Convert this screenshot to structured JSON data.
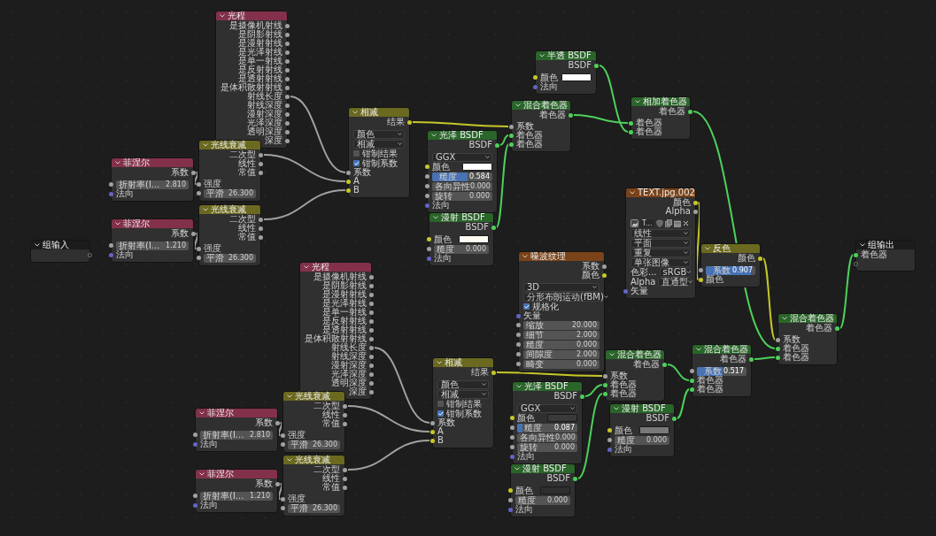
{
  "nodes": [
    {
      "title": "组输入",
      "kind": "group",
      "rows": [
        {
          "kind": "empty_output"
        }
      ]
    },
    {
      "title": "光程",
      "kind": "input",
      "rows": [
        {
          "kind": "output",
          "label": "是摄像机射线",
          "socket": {
            "color": "#a1a1a1"
          }
        },
        {
          "kind": "output",
          "label": "是阴影射线",
          "socket": {
            "color": "#a1a1a1"
          }
        },
        {
          "kind": "output",
          "label": "是漫射射线",
          "socket": {
            "color": "#a1a1a1"
          }
        },
        {
          "kind": "output",
          "label": "是光泽射线",
          "socket": {
            "color": "#a1a1a1"
          }
        },
        {
          "kind": "output",
          "label": "是单一射线",
          "socket": {
            "color": "#a1a1a1"
          }
        },
        {
          "kind": "output",
          "label": "是反射射线",
          "socket": {
            "color": "#a1a1a1"
          }
        },
        {
          "kind": "output",
          "label": "是透射射线",
          "socket": {
            "color": "#a1a1a1"
          }
        },
        {
          "kind": "output",
          "label": "是体积散射射线",
          "socket": {
            "color": "#a1a1a1"
          }
        },
        {
          "kind": "output",
          "label": "射线长度",
          "socket": {
            "color": "#a1a1a1"
          }
        },
        {
          "kind": "output",
          "label": "射线深度",
          "socket": {
            "color": "#a1a1a1"
          }
        },
        {
          "kind": "output",
          "label": "漫射深度",
          "socket": {
            "color": "#a1a1a1"
          }
        },
        {
          "kind": "output",
          "label": "光泽深度",
          "socket": {
            "color": "#a1a1a1"
          }
        },
        {
          "kind": "output",
          "label": "透明深度",
          "socket": {
            "color": "#a1a1a1"
          }
        },
        {
          "kind": "output",
          "label": "深度",
          "socket": {
            "color": "#a1a1a1"
          }
        }
      ]
    },
    {
      "title": "菲涅尔",
      "kind": "input",
      "rows": [
        {
          "kind": "output",
          "label": "系数",
          "socket": {
            "color": "#a1a1a1"
          }
        },
        {
          "kind": "field",
          "label": "折射率(I...",
          "value": "2.810",
          "socket": {
            "color": "#a1a1a1"
          }
        },
        {
          "kind": "input",
          "label": "法向",
          "socket": {
            "color": "#6363c7"
          }
        }
      ]
    },
    {
      "title": "光线衰减",
      "kind": "color",
      "rows": [
        {
          "kind": "output",
          "label": "二次型",
          "socket": {
            "color": "#a1a1a1"
          }
        },
        {
          "kind": "output",
          "label": "线性",
          "socket": {
            "color": "#a1a1a1"
          }
        },
        {
          "kind": "output",
          "label": "常值",
          "socket": {
            "color": "#a1a1a1"
          }
        },
        {
          "kind": "input",
          "label": "强度",
          "socket": {
            "color": "#a1a1a1"
          }
        },
        {
          "kind": "field",
          "label": "平滑",
          "value": "26.300",
          "socket": {
            "color": "#a1a1a1"
          }
        }
      ]
    },
    {
      "title": "菲涅尔",
      "kind": "input",
      "rows": [
        {
          "kind": "output",
          "label": "系数",
          "socket": {
            "color": "#a1a1a1"
          }
        },
        {
          "kind": "field",
          "label": "折射率(I...",
          "value": "1.210",
          "socket": {
            "color": "#a1a1a1"
          }
        },
        {
          "kind": "input",
          "label": "法向",
          "socket": {
            "color": "#6363c7"
          }
        }
      ]
    },
    {
      "title": "光线衰减",
      "kind": "color",
      "rows": [
        {
          "kind": "output",
          "label": "二次型",
          "socket": {
            "color": "#a1a1a1"
          }
        },
        {
          "kind": "output",
          "label": "线性",
          "socket": {
            "color": "#a1a1a1"
          }
        },
        {
          "kind": "output",
          "label": "常值",
          "socket": {
            "color": "#a1a1a1"
          }
        },
        {
          "kind": "input",
          "label": "强度",
          "socket": {
            "color": "#a1a1a1"
          }
        },
        {
          "kind": "field",
          "label": "平滑",
          "value": "26.300",
          "socket": {
            "color": "#a1a1a1"
          }
        }
      ]
    },
    {
      "title": "相减",
      "kind": "color",
      "rows": [
        {
          "kind": "output",
          "label": "结果",
          "socket": {
            "color": "#c7c729"
          }
        },
        {
          "kind": "dropdown",
          "value": "颜色"
        },
        {
          "kind": "dropdown",
          "value": "相减"
        },
        {
          "kind": "checkbox",
          "label": "钳制结果",
          "checked": false
        },
        {
          "kind": "checkbox",
          "label": "钳制系数",
          "checked": true
        },
        {
          "kind": "input",
          "label": "系数",
          "socket": {
            "color": "#a1a1a1"
          }
        },
        {
          "kind": "input",
          "label": "A",
          "socket": {
            "color": "#c7c729"
          }
        },
        {
          "kind": "input",
          "label": "B",
          "socket": {
            "color": "#c7c729"
          }
        }
      ]
    },
    {
      "title": "光泽 BSDF",
      "kind": "shader",
      "rows": [
        {
          "kind": "output",
          "label": "BSDF",
          "socket": {
            "color": "#4dd05a"
          }
        },
        {
          "kind": "dropdown",
          "value": "GGX"
        },
        {
          "kind": "color",
          "label": "颜色",
          "color": "#ffffff",
          "socket": {
            "color": "#c7c729"
          }
        },
        {
          "kind": "slider",
          "label": "糙度",
          "value": "0.584",
          "level": 0.584,
          "socket": {
            "color": "#a1a1a1"
          }
        },
        {
          "kind": "field",
          "label": "各向异性",
          "value": "0.000",
          "socket": {
            "color": "#a1a1a1"
          }
        },
        {
          "kind": "field",
          "label": "旋转",
          "value": "0.000",
          "socket": {
            "color": "#a1a1a1"
          }
        },
        {
          "kind": "input",
          "label": "法向",
          "socket": {
            "color": "#6363c7"
          }
        }
      ]
    },
    {
      "title": "漫射 BSDF",
      "kind": "shader",
      "rows": [
        {
          "kind": "output",
          "label": "BSDF",
          "socket": {
            "color": "#4dd05a"
          }
        },
        {
          "kind": "color",
          "label": "颜色",
          "color": "#fffaf2",
          "socket": {
            "color": "#c7c729"
          }
        },
        {
          "kind": "field",
          "label": "糙度",
          "value": "0.000",
          "socket": {
            "color": "#a1a1a1"
          }
        },
        {
          "kind": "input",
          "label": "法向",
          "socket": {
            "color": "#6363c7"
          }
        }
      ]
    },
    {
      "title": "半透 BSDF",
      "kind": "shader",
      "rows": [
        {
          "kind": "output",
          "label": "BSDF",
          "socket": {
            "color": "#4dd05a"
          }
        },
        {
          "kind": "color",
          "label": "颜色",
          "color": "#ffffff",
          "socket": {
            "color": "#c7c729"
          }
        },
        {
          "kind": "input",
          "label": "法向",
          "socket": {
            "color": "#6363c7"
          }
        }
      ]
    },
    {
      "title": "混合着色器",
      "kind": "shader",
      "rows": [
        {
          "kind": "output",
          "label": "着色器",
          "socket": {
            "color": "#4dd05a"
          }
        },
        {
          "kind": "input",
          "label": "系数",
          "socket": {
            "color": "#a1a1a1"
          }
        },
        {
          "kind": "input",
          "label": "着色器",
          "socket": {
            "color": "#4dd05a"
          }
        },
        {
          "kind": "input",
          "label": "着色器",
          "socket": {
            "color": "#4dd05a"
          }
        }
      ]
    },
    {
      "title": "相加着色器",
      "kind": "shader",
      "rows": [
        {
          "kind": "output",
          "label": "着色器",
          "socket": {
            "color": "#4dd05a"
          }
        },
        {
          "kind": "input",
          "label": "着色器",
          "socket": {
            "color": "#4dd05a"
          }
        },
        {
          "kind": "input",
          "label": "着色器",
          "socket": {
            "color": "#4dd05a"
          }
        }
      ]
    },
    {
      "title": "TEXT.jpg.002",
      "kind": "texture",
      "rows": [
        {
          "kind": "output",
          "label": "颜色",
          "socket": {
            "color": "#c7c729"
          }
        },
        {
          "kind": "output",
          "label": "Alpha",
          "socket": {
            "color": "#a1a1a1"
          }
        },
        {
          "kind": "image_selector",
          "value": "T..."
        },
        {
          "kind": "dropdown",
          "value": "线性"
        },
        {
          "kind": "dropdown",
          "value": "平面"
        },
        {
          "kind": "dropdown",
          "value": "重复"
        },
        {
          "kind": "dropdown",
          "value": "单张图像"
        },
        {
          "kind": "labeled_dropdown",
          "label": "色彩...",
          "value": "sRGB"
        },
        {
          "kind": "labeled_dropdown",
          "label": "Alpha",
          "value": "直通型"
        },
        {
          "kind": "input",
          "label": "矢量",
          "socket": {
            "color": "#6363c7"
          }
        }
      ]
    },
    {
      "title": "反色",
      "kind": "color",
      "rows": [
        {
          "kind": "output",
          "label": "颜色",
          "socket": {
            "color": "#c7c729"
          }
        },
        {
          "kind": "slider",
          "label": "系数",
          "value": "0.907",
          "level": 0.907,
          "socket": {
            "color": "#a1a1a1"
          }
        },
        {
          "kind": "input",
          "label": "颜色",
          "socket": {
            "color": "#c7c729"
          }
        }
      ]
    },
    {
      "title": "组输出",
      "kind": "group",
      "rows": [
        {
          "kind": "input",
          "label": "着色器",
          "socket": {
            "color": "#4dd05a"
          }
        },
        {
          "kind": "empty_input"
        }
      ]
    },
    {
      "title": "光程",
      "kind": "input",
      "rows": [
        {
          "kind": "output",
          "label": "是摄像机射线",
          "socket": {
            "color": "#a1a1a1"
          }
        },
        {
          "kind": "output",
          "label": "是阴影射线",
          "socket": {
            "color": "#a1a1a1"
          }
        },
        {
          "kind": "output",
          "label": "是漫射射线",
          "socket": {
            "color": "#a1a1a1"
          }
        },
        {
          "kind": "output",
          "label": "是光泽射线",
          "socket": {
            "color": "#a1a1a1"
          }
        },
        {
          "kind": "output",
          "label": "是单一射线",
          "socket": {
            "color": "#a1a1a1"
          }
        },
        {
          "kind": "output",
          "label": "是反射射线",
          "socket": {
            "color": "#a1a1a1"
          }
        },
        {
          "kind": "output",
          "label": "是透射射线",
          "socket": {
            "color": "#a1a1a1"
          }
        },
        {
          "kind": "output",
          "label": "是体积散射射线",
          "socket": {
            "color": "#a1a1a1"
          }
        },
        {
          "kind": "output",
          "label": "射线长度",
          "socket": {
            "color": "#a1a1a1"
          }
        },
        {
          "kind": "output",
          "label": "射线深度",
          "socket": {
            "color": "#a1a1a1"
          }
        },
        {
          "kind": "output",
          "label": "漫射深度",
          "socket": {
            "color": "#a1a1a1"
          }
        },
        {
          "kind": "output",
          "label": "光泽深度",
          "socket": {
            "color": "#a1a1a1"
          }
        },
        {
          "kind": "output",
          "label": "透明深度",
          "socket": {
            "color": "#a1a1a1"
          }
        },
        {
          "kind": "output",
          "label": "深度",
          "socket": {
            "color": "#a1a1a1"
          }
        }
      ]
    },
    {
      "title": "菲涅尔",
      "kind": "input",
      "rows": [
        {
          "kind": "output",
          "label": "系数",
          "socket": {
            "color": "#a1a1a1"
          }
        },
        {
          "kind": "field",
          "label": "折射率(I...",
          "value": "2.810",
          "socket": {
            "color": "#a1a1a1"
          }
        },
        {
          "kind": "input",
          "label": "法向",
          "socket": {
            "color": "#6363c7"
          }
        }
      ]
    },
    {
      "title": "光线衰减",
      "kind": "color",
      "rows": [
        {
          "kind": "output",
          "label": "二次型",
          "socket": {
            "color": "#a1a1a1"
          }
        },
        {
          "kind": "output",
          "label": "线性",
          "socket": {
            "color": "#a1a1a1"
          }
        },
        {
          "kind": "output",
          "label": "常值",
          "socket": {
            "color": "#a1a1a1"
          }
        },
        {
          "kind": "input",
          "label": "强度",
          "socket": {
            "color": "#a1a1a1"
          }
        },
        {
          "kind": "field",
          "label": "平滑",
          "value": "26.300",
          "socket": {
            "color": "#a1a1a1"
          }
        }
      ]
    },
    {
      "title": "菲涅尔",
      "kind": "input",
      "rows": [
        {
          "kind": "output",
          "label": "系数",
          "socket": {
            "color": "#a1a1a1"
          }
        },
        {
          "kind": "field",
          "label": "折射率(I...",
          "value": "1.210",
          "socket": {
            "color": "#a1a1a1"
          }
        },
        {
          "kind": "input",
          "label": "法向",
          "socket": {
            "color": "#6363c7"
          }
        }
      ]
    },
    {
      "title": "光线衰减",
      "kind": "color",
      "rows": [
        {
          "kind": "output",
          "label": "二次型",
          "socket": {
            "color": "#a1a1a1"
          }
        },
        {
          "kind": "output",
          "label": "线性",
          "socket": {
            "color": "#a1a1a1"
          }
        },
        {
          "kind": "output",
          "label": "常值",
          "socket": {
            "color": "#a1a1a1"
          }
        },
        {
          "kind": "input",
          "label": "强度",
          "socket": {
            "color": "#a1a1a1"
          }
        },
        {
          "kind": "field",
          "label": "平滑",
          "value": "26.300",
          "socket": {
            "color": "#a1a1a1"
          }
        }
      ]
    },
    {
      "title": "相减",
      "kind": "color",
      "rows": [
        {
          "kind": "output",
          "label": "结果",
          "socket": {
            "color": "#c7c729"
          }
        },
        {
          "kind": "dropdown",
          "value": "颜色"
        },
        {
          "kind": "dropdown",
          "value": "相减"
        },
        {
          "kind": "checkbox",
          "label": "钳制结果",
          "checked": false
        },
        {
          "kind": "checkbox",
          "label": "钳制系数",
          "checked": true
        },
        {
          "kind": "input",
          "label": "系数",
          "socket": {
            "color": "#a1a1a1"
          }
        },
        {
          "kind": "input",
          "label": "A",
          "socket": {
            "color": "#c7c729"
          }
        },
        {
          "kind": "input",
          "label": "B",
          "socket": {
            "color": "#c7c729"
          }
        }
      ]
    },
    {
      "title": "噪波纹理",
      "kind": "texture",
      "rows": [
        {
          "kind": "output",
          "label": "系数",
          "socket": {
            "color": "#a1a1a1"
          }
        },
        {
          "kind": "output",
          "label": "颜色",
          "socket": {
            "color": "#c7c729"
          }
        },
        {
          "kind": "dropdown",
          "value": "3D"
        },
        {
          "kind": "dropdown",
          "value": "分形布朗运动(fBM)"
        },
        {
          "kind": "checkbox",
          "label": "规格化",
          "checked": true
        },
        {
          "kind": "input",
          "label": "矢量",
          "socket": {
            "color": "#6363c7"
          }
        },
        {
          "kind": "field",
          "label": "缩放",
          "value": "20.000",
          "socket": {
            "color": "#a1a1a1"
          }
        },
        {
          "kind": "field",
          "label": "细节",
          "value": "2.000",
          "socket": {
            "color": "#a1a1a1"
          }
        },
        {
          "kind": "field",
          "label": "糙度",
          "value": "0.000",
          "socket": {
            "color": "#a1a1a1"
          }
        },
        {
          "kind": "field",
          "label": "间隙度",
          "value": "2.000",
          "socket": {
            "color": "#a1a1a1"
          }
        },
        {
          "kind": "field",
          "label": "畸变",
          "value": "0.000",
          "socket": {
            "color": "#a1a1a1"
          }
        }
      ]
    },
    {
      "title": "光泽 BSDF",
      "kind": "shader",
      "rows": [
        {
          "kind": "output",
          "label": "BSDF",
          "socket": {
            "color": "#4dd05a"
          }
        },
        {
          "kind": "dropdown",
          "value": "GGX"
        },
        {
          "kind": "color",
          "label": "颜色",
          "color": "#3a3a3a",
          "socket": {
            "color": "#c7c729"
          }
        },
        {
          "kind": "slider",
          "label": "糙度",
          "value": "0.087",
          "level": 0.087,
          "socket": {
            "color": "#a1a1a1"
          }
        },
        {
          "kind": "field",
          "label": "各向异性",
          "value": "0.000",
          "socket": {
            "color": "#a1a1a1"
          }
        },
        {
          "kind": "field",
          "label": "旋转",
          "value": "0.000",
          "socket": {
            "color": "#a1a1a1"
          }
        },
        {
          "kind": "input",
          "label": "法向",
          "socket": {
            "color": "#6363c7"
          }
        }
      ]
    },
    {
      "title": "漫射 BSDF",
      "kind": "shader",
      "rows": [
        {
          "kind": "output",
          "label": "BSDF",
          "socket": {
            "color": "#4dd05a"
          }
        },
        {
          "kind": "color",
          "label": "颜色",
          "color": "#2e2e2e",
          "socket": {
            "color": "#c7c729"
          }
        },
        {
          "kind": "field",
          "label": "糙度",
          "value": "0.000",
          "socket": {
            "color": "#a1a1a1"
          }
        },
        {
          "kind": "input",
          "label": "法向",
          "socket": {
            "color": "#6363c7"
          }
        }
      ]
    },
    {
      "title": "混合着色器",
      "kind": "shader",
      "rows": [
        {
          "kind": "output",
          "label": "着色器",
          "socket": {
            "color": "#4dd05a"
          }
        },
        {
          "kind": "input",
          "label": "系数",
          "socket": {
            "color": "#a1a1a1"
          }
        },
        {
          "kind": "input",
          "label": "着色器",
          "socket": {
            "color": "#4dd05a"
          }
        },
        {
          "kind": "input",
          "label": "着色器",
          "socket": {
            "color": "#4dd05a"
          }
        }
      ]
    },
    {
      "title": "漫射 BSDF",
      "kind": "shader",
      "rows": [
        {
          "kind": "output",
          "label": "BSDF",
          "socket": {
            "color": "#4dd05a"
          }
        },
        {
          "kind": "color",
          "label": "颜色",
          "color": "#7a7a7a",
          "socket": {
            "color": "#c7c729"
          }
        },
        {
          "kind": "field",
          "label": "糙度",
          "value": "0.000",
          "socket": {
            "color": "#a1a1a1"
          }
        },
        {
          "kind": "input",
          "label": "法向",
          "socket": {
            "color": "#6363c7"
          }
        }
      ]
    },
    {
      "title": "混合着色器",
      "kind": "shader",
      "rows": [
        {
          "kind": "output",
          "label": "着色器",
          "socket": {
            "color": "#4dd05a"
          }
        },
        {
          "kind": "slider",
          "label": "系数",
          "value": "0.517",
          "level": 0.517,
          "socket": {
            "color": "#a1a1a1"
          }
        },
        {
          "kind": "input",
          "label": "着色器",
          "socket": {
            "color": "#4dd05a"
          }
        },
        {
          "kind": "input",
          "label": "着色器",
          "socket": {
            "color": "#4dd05a"
          }
        }
      ]
    },
    {
      "title": "混合着色器",
      "kind": "shader",
      "rows": [
        {
          "kind": "output",
          "label": "着色器",
          "socket": {
            "color": "#4dd05a"
          }
        },
        {
          "kind": "input",
          "label": "系数",
          "socket": {
            "color": "#a1a1a1"
          }
        },
        {
          "kind": "input",
          "label": "着色器",
          "socket": {
            "color": "#4dd05a"
          }
        },
        {
          "kind": "input",
          "label": "着色器",
          "socket": {
            "color": "#4dd05a"
          }
        }
      ]
    }
  ]
}
